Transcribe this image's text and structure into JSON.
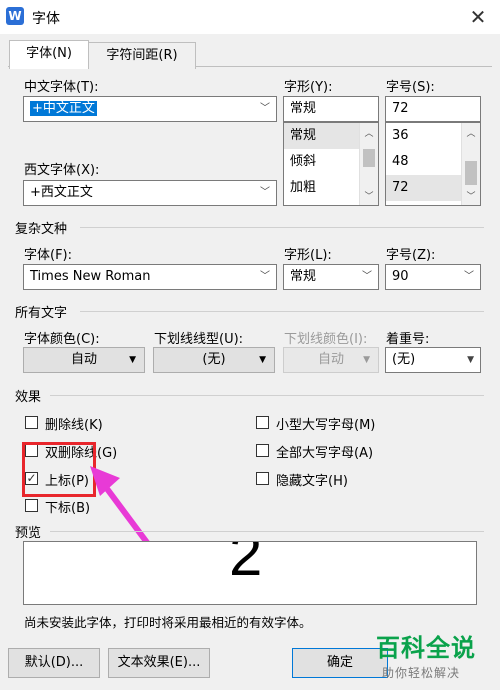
{
  "window": {
    "title": "字体",
    "app_icon": "W"
  },
  "tabs": [
    {
      "label": "字体(N)"
    },
    {
      "label": "字符间距(R)"
    }
  ],
  "chinese": {
    "font_label": "中文字体(T):",
    "font_value": "+中文正文",
    "style_label": "字形(Y):",
    "style_value": "常规",
    "style_options": [
      "常规",
      "倾斜",
      "加粗"
    ],
    "size_label": "字号(S):",
    "size_value": "72",
    "size_options": [
      "36",
      "48",
      "72"
    ]
  },
  "western": {
    "font_label": "西文字体(X):",
    "font_value": "+西文正文"
  },
  "complex": {
    "section_title": "复杂文种",
    "font_label": "字体(F):",
    "font_value": "Times New Roman",
    "style_label": "字形(L):",
    "style_value": "常规",
    "size_label": "字号(Z):",
    "size_value": "90"
  },
  "all_text": {
    "section_title": "所有文字",
    "color_label": "字体颜色(C):",
    "color_value": "自动",
    "underline_type_label": "下划线线型(U):",
    "underline_type_value": "(无)",
    "underline_color_label": "下划线颜色(I):",
    "underline_color_value": "自动",
    "emphasis_label": "着重号:",
    "emphasis_value": "(无)"
  },
  "effects": {
    "section_title": "效果",
    "strikethrough": {
      "label": "删除线(K)",
      "checked": false
    },
    "double_strikethrough": {
      "label": "双删除线(G)",
      "checked": false
    },
    "superscript": {
      "label": "上标(P)",
      "checked": true
    },
    "subscript": {
      "label": "下标(B)",
      "checked": false
    },
    "small_caps": {
      "label": "小型大写字母(M)",
      "checked": false
    },
    "all_caps": {
      "label": "全部大写字母(A)",
      "checked": false
    },
    "hidden": {
      "label": "隐藏文字(H)",
      "checked": false
    }
  },
  "preview": {
    "section_title": "预览",
    "sample_text": "2"
  },
  "notice": "尚未安装此字体，打印时将采用最相近的有效字体。",
  "buttons": {
    "default": "默认(D)...",
    "text_effects": "文本效果(E)...",
    "ok": "确定"
  },
  "watermark": {
    "title": "百科全说",
    "subtitle": "助你轻松解决"
  },
  "colors": {
    "accent": "#0078d7",
    "highlight": "#e8262c",
    "arrow": "#e83ad6",
    "watermark": "#0aa24b"
  }
}
